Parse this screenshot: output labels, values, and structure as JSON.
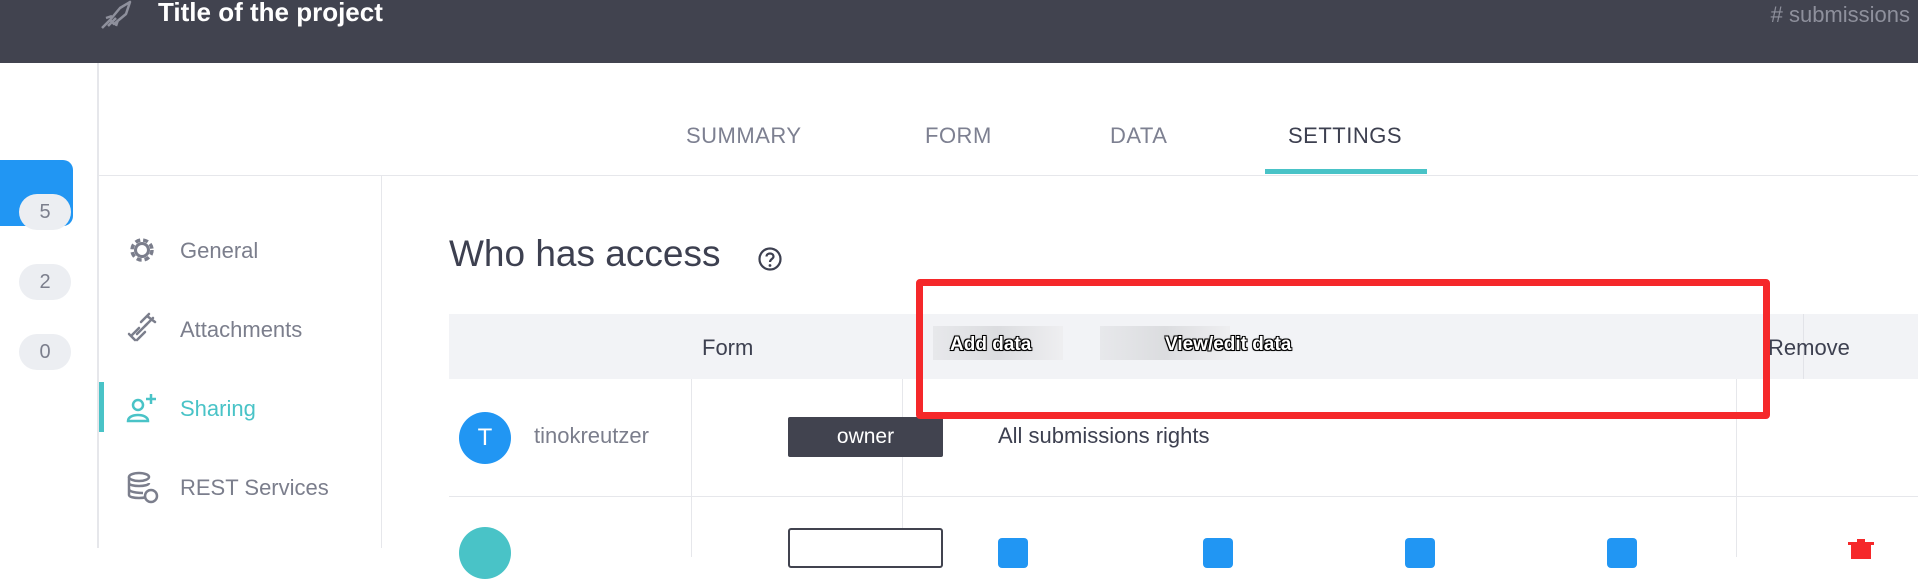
{
  "header": {
    "title": "Title of the project",
    "submissions_label": "# submissions",
    "logo_icon": "rocket-icon"
  },
  "rail": {
    "counts": [
      "5",
      "2",
      "0"
    ]
  },
  "tabs": [
    {
      "label": "SUMMARY",
      "active": false
    },
    {
      "label": "FORM",
      "active": false
    },
    {
      "label": "DATA",
      "active": false
    },
    {
      "label": "SETTINGS",
      "active": true
    }
  ],
  "settings_nav": [
    {
      "label": "General",
      "icon": "gear-icon",
      "active": false
    },
    {
      "label": "Attachments",
      "icon": "link-icon",
      "active": false
    },
    {
      "label": "Sharing",
      "icon": "user-add-icon",
      "active": true
    },
    {
      "label": "REST Services",
      "icon": "database-sync-icon",
      "active": false
    }
  ],
  "sharing": {
    "heading": "Who has access",
    "columns": {
      "form": "Form",
      "add_data": "Add data",
      "view_edit_data": "View/edit data",
      "remove": "Remove"
    },
    "rows": [
      {
        "avatar_letter": "T",
        "username": "tinokreutzer",
        "role": "owner",
        "rights": "All submissions rights"
      }
    ]
  },
  "colors": {
    "topbar": "#41434f",
    "primary": "#2196f3",
    "accent": "#49c3c7",
    "highlight": "#f5282a"
  }
}
